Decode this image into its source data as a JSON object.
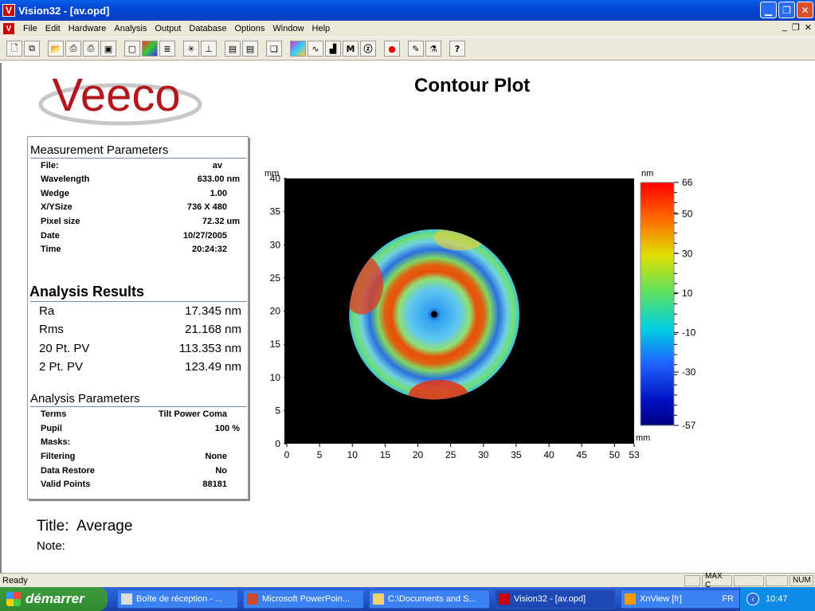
{
  "window": {
    "title": "Vision32 - [av.opd]",
    "app_icon": "V"
  },
  "menu": [
    "File",
    "Edit",
    "Hardware",
    "Analysis",
    "Output",
    "Database",
    "Options",
    "Window",
    "Help"
  ],
  "toolbar_icons": [
    "new-doc-icon",
    "copy-doc-icon",
    "open-folder-icon",
    "print-setup-icon",
    "print-icon",
    "save-icon",
    "blank-page-icon",
    "color-map-icon",
    "data-icon",
    "sparkle-icon",
    "measure-icon",
    "window1-icon",
    "window2-icon",
    "copy-icon",
    "plot3d-icon",
    "profile-icon",
    "histogram-icon",
    "m-icon",
    "z-icon",
    "record-icon",
    "marker-icon",
    "flask-icon",
    "help-icon"
  ],
  "report": {
    "logo_text": "Veeco",
    "plot_title": "Contour Plot",
    "measurement": {
      "heading": "Measurement Parameters",
      "rows": [
        {
          "label": "File:",
          "value": "av"
        },
        {
          "label": "Wavelength",
          "value": "633.00 nm"
        },
        {
          "label": "Wedge",
          "value": "1.00"
        },
        {
          "label": "X/YSize",
          "value": "736 X 480"
        },
        {
          "label": "Pixel size",
          "value": "72.32 um"
        },
        {
          "label": "Date",
          "value": "10/27/2005"
        },
        {
          "label": "Time",
          "value": "20:24:32"
        }
      ]
    },
    "results": {
      "heading": "Analysis Results",
      "rows": [
        {
          "label": "Ra",
          "value": "17.345 nm"
        },
        {
          "label": "Rms",
          "value": "21.168 nm"
        },
        {
          "label": "20 Pt. PV",
          "value": "113.353 nm"
        },
        {
          "label": "2 Pt. PV",
          "value": "123.49 nm"
        }
      ]
    },
    "params": {
      "heading": "Analysis Parameters",
      "rows": [
        {
          "label": "Terms",
          "value": "Tilt Power Coma"
        },
        {
          "label": "Pupil",
          "value": "100 %"
        },
        {
          "label": "Masks:",
          "value": ""
        },
        {
          "label": "Filtering",
          "value": "None"
        },
        {
          "label": "Data Restore",
          "value": "No"
        },
        {
          "label": "Valid Points",
          "value": "88181"
        }
      ]
    },
    "title_label": "Title:",
    "title_value": "Average",
    "note_label": "Note:"
  },
  "chart_data": {
    "type": "heatmap",
    "title": "Contour Plot",
    "x_unit": "mm",
    "y_unit": "mm",
    "xlim": [
      0,
      53
    ],
    "ylim": [
      0,
      40
    ],
    "x_ticks": [
      0,
      5,
      10,
      15,
      20,
      25,
      30,
      35,
      40,
      45,
      50,
      53
    ],
    "y_ticks": [
      0,
      5,
      10,
      15,
      20,
      25,
      30,
      35,
      40
    ],
    "colorbar": {
      "unit": "nm",
      "range": [
        -57,
        66
      ],
      "ticks": [
        66,
        50,
        30,
        10,
        -10,
        -30,
        -57
      ]
    },
    "aperture_center_mm": [
      22.5,
      19.5
    ],
    "aperture_radius_mm": 13
  },
  "status": {
    "left": "Ready",
    "cells": [
      "",
      "MAX C",
      "",
      "",
      "NUM"
    ]
  },
  "taskbar": {
    "start": "démarrer",
    "tasks": [
      "Boîte de réception - ...",
      "Microsoft PowerPoin...",
      "C:\\Documents and S...",
      "Vision32 - [av.opd]",
      "XnView [fr]"
    ],
    "lang": "FR",
    "clock": "10:47"
  }
}
